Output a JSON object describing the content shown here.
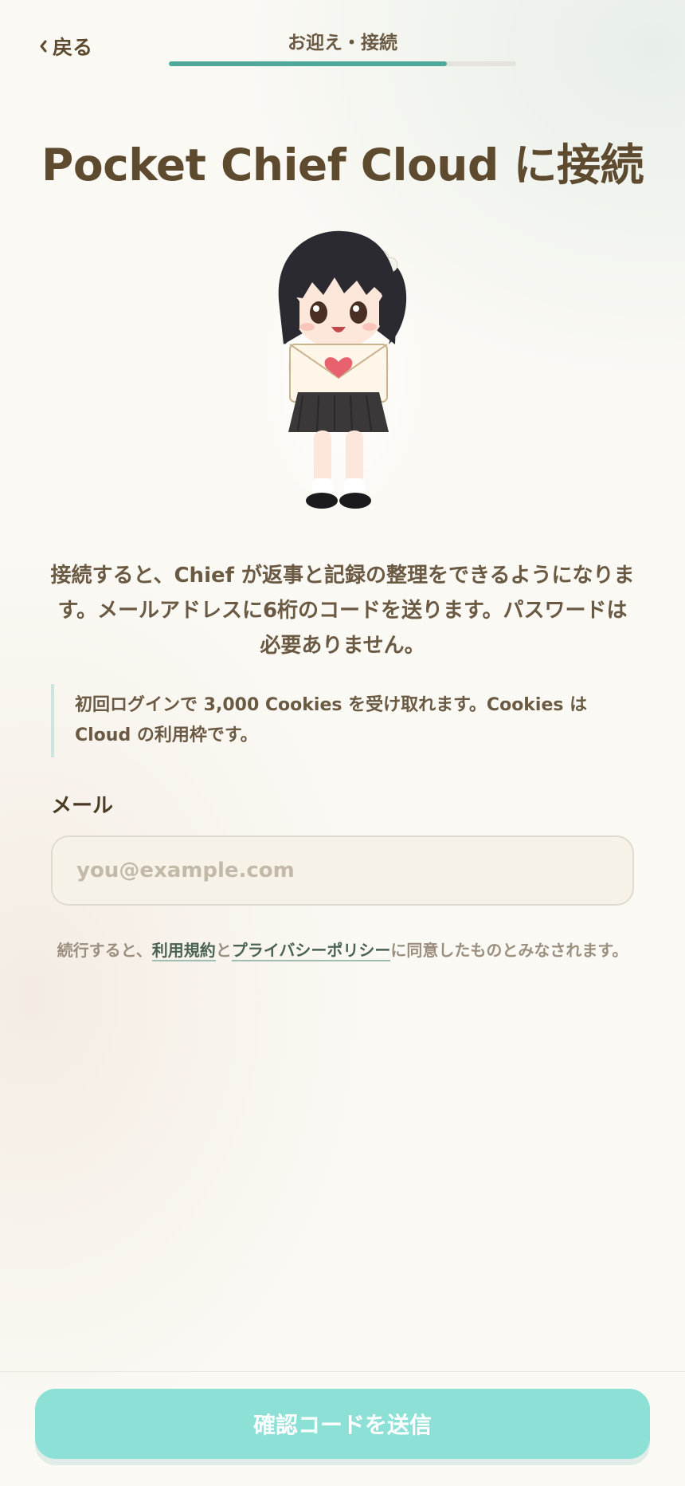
{
  "header": {
    "back_label": "戻る",
    "step_title": "お迎え・接続",
    "progress": 0.8
  },
  "main": {
    "title": "Pocket Chief Cloud に接続",
    "description": "接続すると、Chief が返事と記録の整理をできるようになります。メールアドレスに6桁のコードを送ります。パスワードは必要ありません。",
    "notice": "初回ログインで 3,000 Cookies を受け取れます。Cookies は Cloud の利用枠です。",
    "email_label": "メール",
    "email_placeholder": "you@example.com",
    "email_value": "",
    "terms": {
      "prefix": "続行すると、",
      "terms_link": "利用規約",
      "middle": "と",
      "privacy_link": "プライバシーポリシー",
      "suffix": "に同意したものとみなされます。"
    }
  },
  "footer": {
    "submit_label": "確認コードを送信"
  },
  "colors": {
    "accent": "#4ea99b",
    "button": "#8ce0d5",
    "text": "#5e4a2e"
  }
}
